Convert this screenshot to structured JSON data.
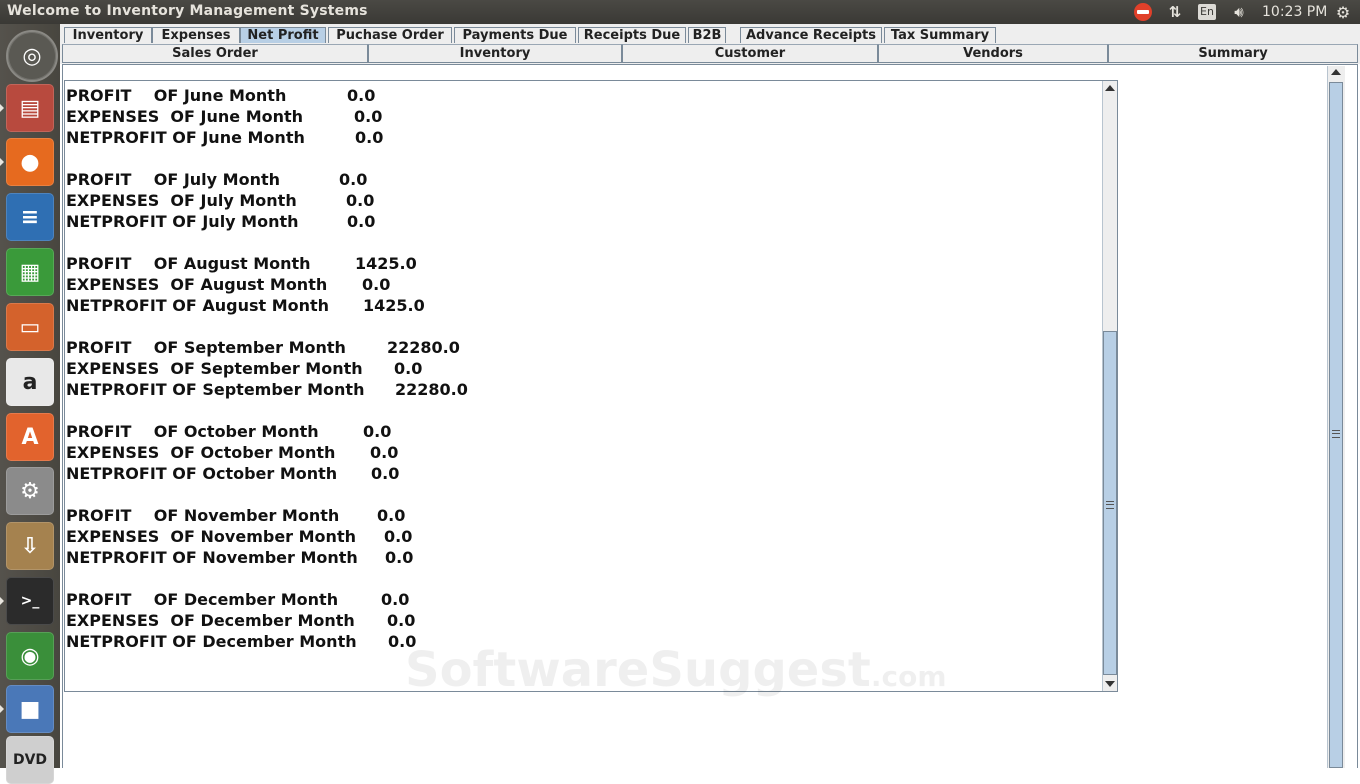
{
  "top_panel": {
    "window_title": "Welcome to Inventory Management Systems",
    "keyboard_layout": "En",
    "clock": "10:23 PM"
  },
  "launcher": {
    "items": [
      {
        "name": "ubuntu-dash-icon",
        "glyph": "◎",
        "color": "#6b6a66"
      },
      {
        "name": "files-icon",
        "glyph": "▤",
        "color": "#b84a3e"
      },
      {
        "name": "firefox-icon",
        "glyph": "●",
        "color": "#e66a1f"
      },
      {
        "name": "writer-icon",
        "glyph": "≡",
        "color": "#2f6fb3"
      },
      {
        "name": "calc-icon",
        "glyph": "▦",
        "color": "#3a9a3a"
      },
      {
        "name": "impress-icon",
        "glyph": "▭",
        "color": "#d4622c"
      },
      {
        "name": "amazon-icon",
        "glyph": "a",
        "color": "#e8e8e8"
      },
      {
        "name": "software-center-icon",
        "glyph": "A",
        "color": "#e2632d"
      },
      {
        "name": "system-settings-icon",
        "glyph": "⚙",
        "color": "#8b8b8b"
      },
      {
        "name": "archive-icon",
        "glyph": "⇩",
        "color": "#a5824f"
      },
      {
        "name": "terminal-icon",
        "glyph": ">_",
        "color": "#2b2b2b"
      },
      {
        "name": "chrome-icon",
        "glyph": "◉",
        "color": "#3a8f3a"
      },
      {
        "name": "virtualbox-icon",
        "glyph": "■",
        "color": "#4a78b8"
      },
      {
        "name": "dvd-icon",
        "glyph": "DVD",
        "color": "#cfcfcf"
      }
    ]
  },
  "tabs": [
    {
      "label": "Inventory",
      "selected": false
    },
    {
      "label": "Expenses",
      "selected": false
    },
    {
      "label": "Net Profit",
      "selected": true
    },
    {
      "label": "Puchase Order",
      "selected": false
    },
    {
      "label": "Payments Due",
      "selected": false
    },
    {
      "label": "Receipts Due",
      "selected": false
    },
    {
      "label": "B2B",
      "selected": false
    },
    {
      "label": "Advance Receipts",
      "selected": false
    },
    {
      "label": "Tax Summary",
      "selected": false
    }
  ],
  "subtabs": [
    {
      "label": "Sales Order"
    },
    {
      "label": "Inventory"
    },
    {
      "label": "Customer"
    },
    {
      "label": "Vendors"
    },
    {
      "label": "Summary"
    }
  ],
  "report": {
    "months": [
      {
        "profit_label": "PROFIT    OF June Month",
        "profit": "0.0",
        "expenses_label": "EXPENSES  OF June Month",
        "expenses": "0.0",
        "net_label": "NETPROFIT OF June Month",
        "net": "0.0"
      },
      {
        "profit_label": "PROFIT    OF July Month",
        "profit": "0.0",
        "expenses_label": "EXPENSES  OF July Month",
        "expenses": "0.0",
        "net_label": "NETPROFIT OF July Month",
        "net": "0.0"
      },
      {
        "profit_label": "PROFIT    OF August Month",
        "profit": "1425.0",
        "expenses_label": "EXPENSES  OF August Month",
        "expenses": "0.0",
        "net_label": "NETPROFIT OF August Month",
        "net": "1425.0"
      },
      {
        "profit_label": "PROFIT    OF September Month",
        "profit": "22280.0",
        "expenses_label": "EXPENSES  OF September Month",
        "expenses": "0.0",
        "net_label": "NETPROFIT OF September Month",
        "net": "22280.0"
      },
      {
        "profit_label": "PROFIT    OF October Month",
        "profit": "0.0",
        "expenses_label": "EXPENSES  OF October Month",
        "expenses": "0.0",
        "net_label": "NETPROFIT OF October Month",
        "net": "0.0"
      },
      {
        "profit_label": "PROFIT    OF November Month",
        "profit": "0.0",
        "expenses_label": "EXPENSES  OF November Month",
        "expenses": "0.0",
        "net_label": "NETPROFIT OF November Month",
        "net": "0.0"
      },
      {
        "profit_label": "PROFIT    OF December Month",
        "profit": "0.0",
        "expenses_label": "EXPENSES  OF December Month",
        "expenses": "0.0",
        "net_label": "NETPROFIT OF December Month",
        "net": "0.0"
      }
    ]
  },
  "watermark": {
    "main": "SoftwareSuggest",
    "suffix": ".com"
  }
}
